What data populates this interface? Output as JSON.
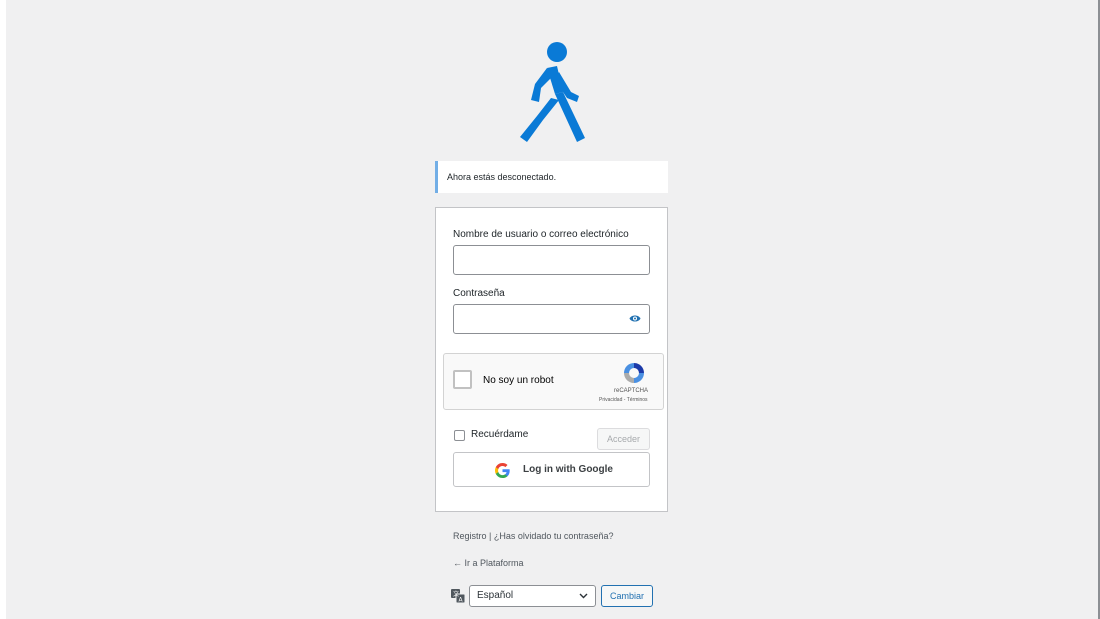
{
  "logo": {
    "icon": "walking-person-icon",
    "color": "#0a7ad6"
  },
  "notice": {
    "text": "Ahora estás desconectado.",
    "accent": "#72aee6"
  },
  "login_form": {
    "username_label": "Nombre de usuario o correo electrónico",
    "username_value": "",
    "password_label": "Contraseña",
    "password_value": "",
    "show_password_icon": "eye-icon",
    "recaptcha": {
      "checkbox_label": "No soy un robot",
      "brand": "reCAPTCHA",
      "terms": "Privacidad - Términos"
    },
    "remember_label": "Recuérdame",
    "remember_checked": false,
    "submit_label": "Acceder",
    "google_button_label": "Log in with Google"
  },
  "footer": {
    "register_link": "Registro",
    "separator": "|",
    "lost_password_link": "¿Has olvidado tu contraseña?",
    "back_link": "← Ir a Plataforma"
  },
  "language": {
    "icon": "translate-icon",
    "selected": "Español",
    "change_button": "Cambiar"
  }
}
